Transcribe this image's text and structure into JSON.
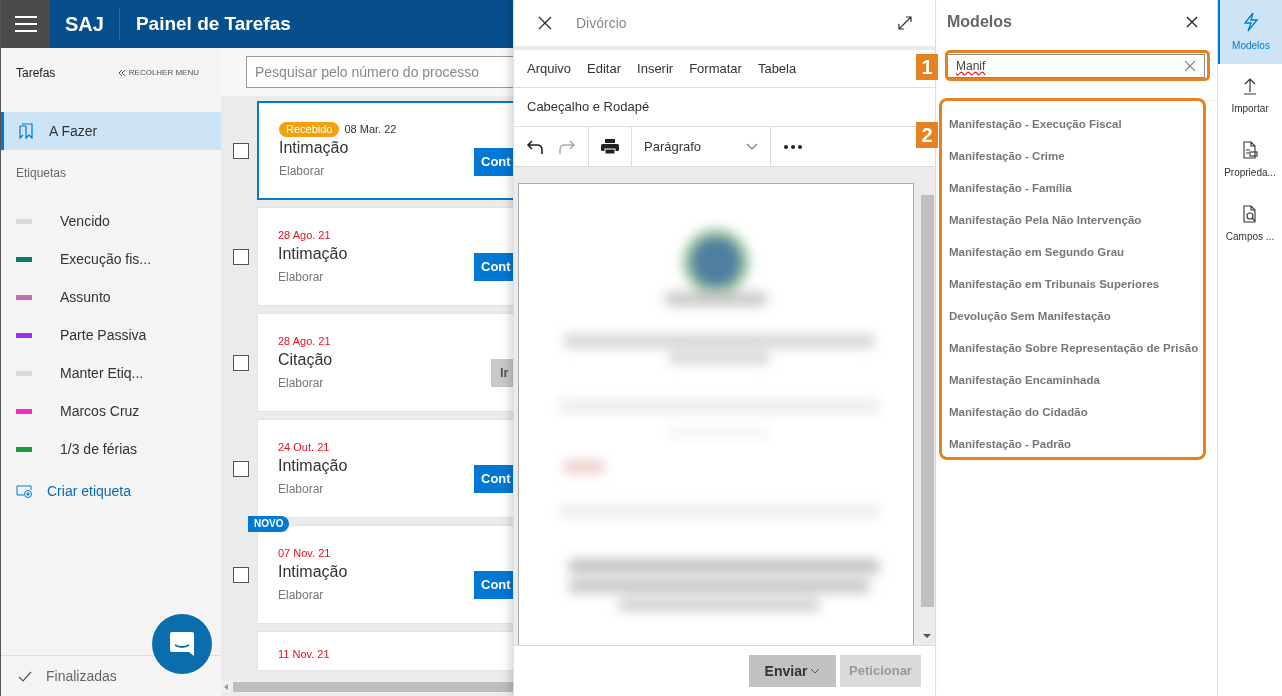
{
  "app": {
    "brand": "SAJ",
    "title": "Painel de Tarefas"
  },
  "sidebar": {
    "heading": "Tarefas",
    "collapse": "RECOLHER MENU",
    "items": [
      {
        "label": "A Fazer",
        "selected": true
      }
    ],
    "tags_heading": "Etiquetas",
    "tags": [
      {
        "label": "Vencido",
        "color": "#d9d9d9"
      },
      {
        "label": "Execução fis...",
        "color": "#0b7a6a"
      },
      {
        "label": "Assunto",
        "color": "#bf6fb3"
      },
      {
        "label": "Parte Passiva",
        "color": "#9b30e6"
      },
      {
        "label": "Manter Etiq...",
        "color": "#d9d9d9"
      },
      {
        "label": "Marcos Cruz",
        "color": "#f02fbd"
      },
      {
        "label": "1/3 de férias",
        "color": "#1a9b3c"
      }
    ],
    "create_tag": "Criar etiqueta",
    "finished": "Finalizadas"
  },
  "tasks": {
    "search": {
      "placeholder": "Pesquisar pelo número do processo"
    },
    "cards": [
      {
        "badge": "Recebido",
        "date": "08 Mar. 22",
        "title": "Intimação",
        "subtitle": "Elaborar",
        "action": "Cont",
        "kind": "primary",
        "selected": true,
        "checked": false
      },
      {
        "date": "28 Ago. 21",
        "title": "Intimação",
        "subtitle": "Elaborar",
        "action": "Cont",
        "kind": "primary",
        "selected": false,
        "checked": false
      },
      {
        "date": "28 Ago. 21",
        "title": "Citação",
        "subtitle": "Elaborar",
        "action": "Ir",
        "kind": "secondary",
        "selected": false,
        "checked": false
      },
      {
        "date": "24 Out. 21",
        "title": "Intimação",
        "subtitle": "Elaborar",
        "action": "Cont",
        "kind": "primary",
        "selected": false,
        "checked": false
      },
      {
        "flag": "NOVO",
        "date": "07 Nov. 21",
        "title": "Intimação",
        "subtitle": "Elaborar",
        "action": "Cont",
        "kind": "primary",
        "selected": false,
        "checked": false
      },
      {
        "date": "11 Nov. 21",
        "selected": false
      }
    ]
  },
  "editor": {
    "title": "Divórcio",
    "menu": [
      "Arquivo",
      "Editar",
      "Inserir",
      "Formatar",
      "Tabela"
    ],
    "menu2": [
      "Cabeçalho e Rodapé"
    ],
    "style": "Parágrafo",
    "send": "Enviar",
    "petition": "Peticionar"
  },
  "models": {
    "title": "Modelos",
    "search": {
      "value": "Manif"
    },
    "items": [
      "Manifestação - Execução Fiscal",
      "Manifestação - Crime",
      "Manifestação - Família",
      "Manifestação Pela Não Intervenção",
      "Manifestação em Segundo Grau",
      "Manifestação em Tribunais Superiores",
      "Devolução Sem Manifestação",
      "Manifestação Sobre Representação de Prisão",
      "Manifestação Encaminhada",
      "Manifestação do Cidadão",
      "Manifestação - Padrão"
    ]
  },
  "rail": [
    {
      "label": "Modelos",
      "selected": true
    },
    {
      "label": "Importar",
      "selected": false
    },
    {
      "label": "Proprieda...",
      "selected": false
    },
    {
      "label": "Campos ...",
      "selected": false
    }
  ],
  "annotations": [
    "1",
    "2"
  ]
}
